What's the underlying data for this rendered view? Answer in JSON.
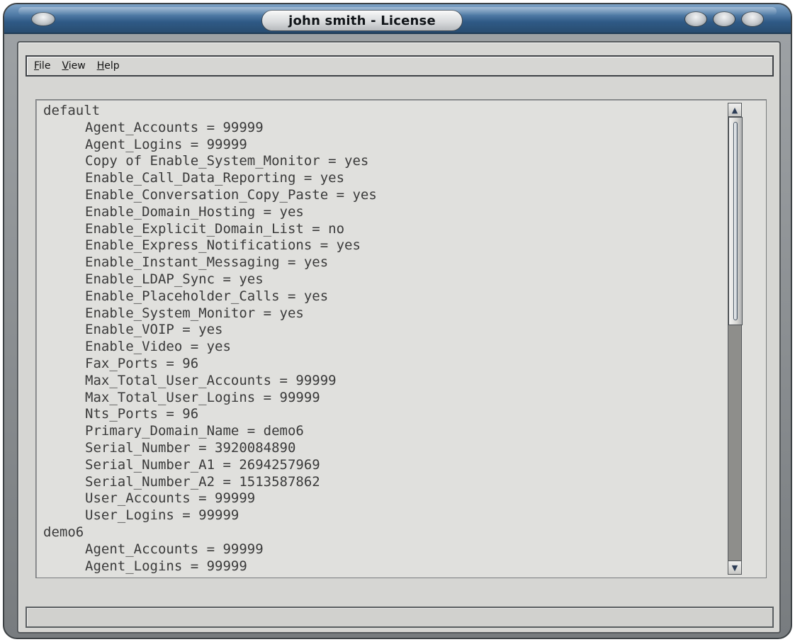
{
  "window": {
    "title": "john smith - License"
  },
  "menu": {
    "items": [
      {
        "label": "File",
        "mnemonic": "F",
        "rest": "ile"
      },
      {
        "label": "View",
        "mnemonic": "V",
        "rest": "iew"
      },
      {
        "label": "Help",
        "mnemonic": "H",
        "rest": "elp"
      }
    ]
  },
  "license_text": {
    "lines": [
      {
        "kind": "section",
        "text": "default"
      },
      {
        "kind": "entry",
        "text": "Agent_Accounts = 99999"
      },
      {
        "kind": "entry",
        "text": "Agent_Logins = 99999"
      },
      {
        "kind": "entry",
        "text": "Copy of Enable_System_Monitor = yes"
      },
      {
        "kind": "entry",
        "text": "Enable_Call_Data_Reporting = yes"
      },
      {
        "kind": "entry",
        "text": "Enable_Conversation_Copy_Paste = yes"
      },
      {
        "kind": "entry",
        "text": "Enable_Domain_Hosting = yes"
      },
      {
        "kind": "entry",
        "text": "Enable_Explicit_Domain_List = no"
      },
      {
        "kind": "entry",
        "text": "Enable_Express_Notifications = yes"
      },
      {
        "kind": "entry",
        "text": "Enable_Instant_Messaging = yes"
      },
      {
        "kind": "entry",
        "text": "Enable_LDAP_Sync = yes"
      },
      {
        "kind": "entry",
        "text": "Enable_Placeholder_Calls = yes"
      },
      {
        "kind": "entry",
        "text": "Enable_System_Monitor = yes"
      },
      {
        "kind": "entry",
        "text": "Enable_VOIP = yes"
      },
      {
        "kind": "entry",
        "text": "Enable_Video = yes"
      },
      {
        "kind": "entry",
        "text": "Fax_Ports = 96"
      },
      {
        "kind": "entry",
        "text": "Max_Total_User_Accounts = 99999"
      },
      {
        "kind": "entry",
        "text": "Max_Total_User_Logins = 99999"
      },
      {
        "kind": "entry",
        "text": "Nts_Ports = 96"
      },
      {
        "kind": "entry",
        "text": "Primary_Domain_Name = demo6"
      },
      {
        "kind": "entry",
        "text": "Serial_Number = 3920084890"
      },
      {
        "kind": "entry",
        "text": "Serial_Number_A1 = 2694257969"
      },
      {
        "kind": "entry",
        "text": "Serial_Number_A2 = 1513587862"
      },
      {
        "kind": "entry",
        "text": "User_Accounts = 99999"
      },
      {
        "kind": "entry",
        "text": "User_Logins = 99999"
      },
      {
        "kind": "section",
        "text": "demo6"
      },
      {
        "kind": "entry",
        "text": "Agent_Accounts = 99999"
      },
      {
        "kind": "entry",
        "text": "Agent_Logins = 99999"
      }
    ]
  },
  "scrollbar": {
    "position_fraction": 0.0,
    "visible_fraction": 0.47,
    "up_arrow_icon": "triangle-up-icon",
    "down_arrow_icon": "triangle-down-icon"
  },
  "status_bar": {
    "text": ""
  },
  "colors": {
    "title_bar": "#2f5a86",
    "client_bg": "#d6d6d3",
    "text_panel_bg": "#e0e0dd",
    "text_color": "#3a3a3a"
  }
}
